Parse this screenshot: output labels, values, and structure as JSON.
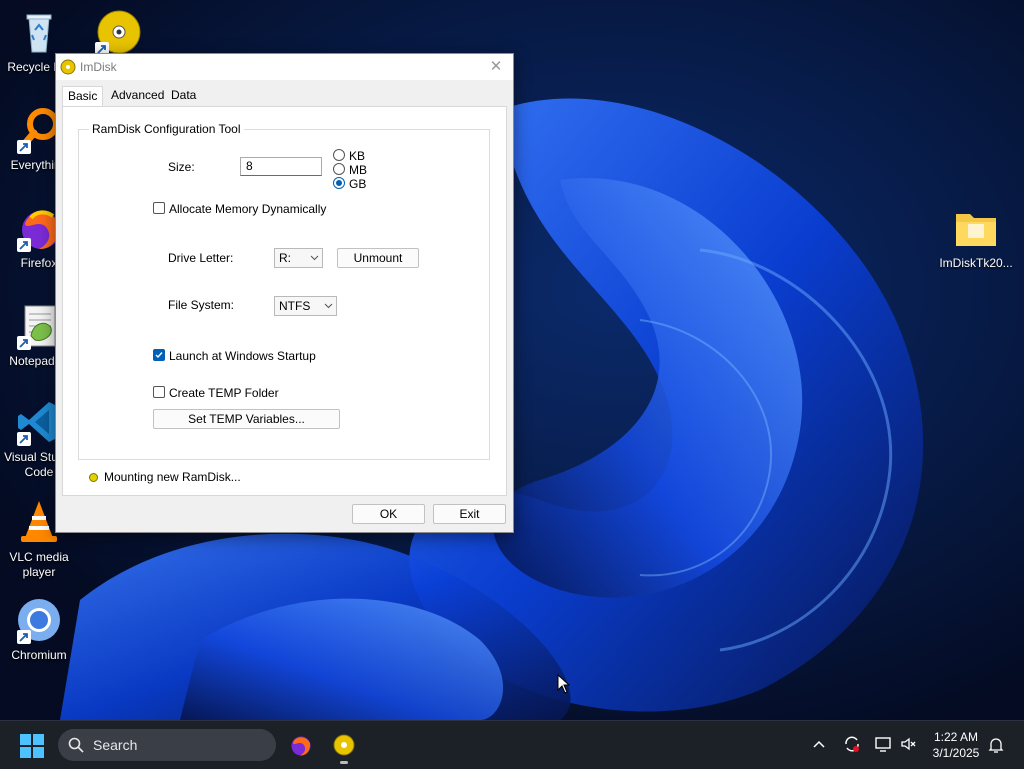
{
  "desktop": {
    "icons": [
      {
        "label": "Recycle Bin"
      },
      {
        "label": "Everything"
      },
      {
        "label": "Firefox"
      },
      {
        "label": "Notepad++"
      },
      {
        "label": "Visual Studio Code"
      },
      {
        "label": "VLC media player"
      },
      {
        "label": "Chromium"
      },
      {
        "label": "ImDiskTk20..."
      }
    ]
  },
  "dialog": {
    "title": "ImDisk",
    "close_glyph": "✕",
    "tabs": [
      {
        "label": "Basic",
        "active": true
      },
      {
        "label": "Advanced",
        "active": false
      },
      {
        "label": "Data",
        "active": false
      }
    ],
    "group_title": "RamDisk Configuration Tool",
    "size_label": "Size:",
    "size_value": "8",
    "units": [
      {
        "label": "KB",
        "checked": false
      },
      {
        "label": "MB",
        "checked": false
      },
      {
        "label": "GB",
        "checked": true
      }
    ],
    "allocate_dynamic": {
      "label": "Allocate Memory Dynamically",
      "checked": false
    },
    "drive_letter_label": "Drive Letter:",
    "drive_letter_value": "R:",
    "unmount_label": "Unmount",
    "file_system_label": "File System:",
    "file_system_value": "NTFS",
    "launch_startup": {
      "label": "Launch at Windows Startup",
      "checked": true
    },
    "create_temp": {
      "label": "Create TEMP Folder",
      "checked": false
    },
    "set_temp_label": "Set TEMP Variables...",
    "status_text": "Mounting new RamDisk...",
    "ok_label": "OK",
    "exit_label": "Exit"
  },
  "taskbar": {
    "search_placeholder": "Search",
    "time": "1:22 AM",
    "date": "3/1/2025"
  },
  "colors": {
    "accent": "#005fb8",
    "status_dot": "#e4d200",
    "taskbar": "#1c2128"
  }
}
